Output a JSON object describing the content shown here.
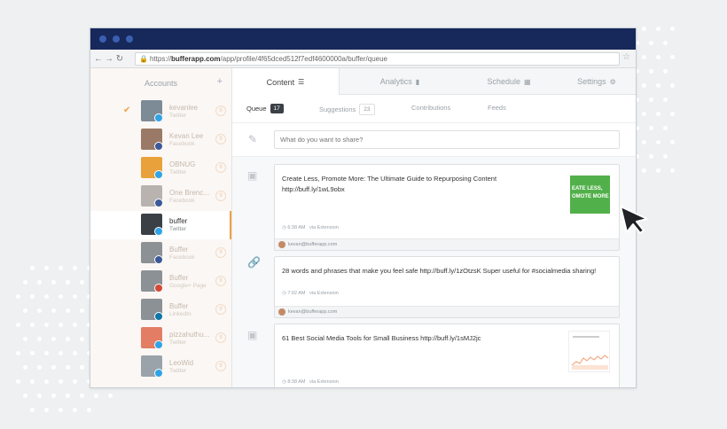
{
  "browser": {
    "url_prefix": "https://",
    "url_host": "bufferapp.com",
    "url_path": "/app/profile/4f65dced512f7edf4600000a/buffer/queue"
  },
  "sidebar": {
    "header": "Accounts",
    "add_symbol": "+",
    "accounts": [
      {
        "name": "kevanlee",
        "network": "Twitter",
        "count": "9",
        "checked": true
      },
      {
        "name": "Kevan Lee",
        "network": "Facebook",
        "count": "9"
      },
      {
        "name": "OBNUG",
        "network": "Twitter",
        "count": "9"
      },
      {
        "name": "One Brenc...",
        "network": "Facebook",
        "count": "9"
      },
      {
        "name": "buffer",
        "network": "Twitter",
        "count": "",
        "active": true
      },
      {
        "name": "Buffer",
        "network": "Facebook",
        "count": "9"
      },
      {
        "name": "Buffer",
        "network": "Google+ Page",
        "count": "9"
      },
      {
        "name": "Buffer",
        "network": "LinkedIn",
        "count": "9"
      },
      {
        "name": "pizzahuthu...",
        "network": "Twitter",
        "count": "9"
      },
      {
        "name": "LeoWid",
        "network": "Twitter",
        "count": "9"
      }
    ]
  },
  "tabs": {
    "content": "Content",
    "analytics": "Analytics",
    "schedule": "Schedule",
    "settings": "Settings"
  },
  "subtabs": {
    "queue": "Queue",
    "queue_count": "17",
    "suggestions": "Suggestions",
    "suggestions_count": "23",
    "contributions": "Contributions",
    "feeds": "Feeds"
  },
  "composer": {
    "placeholder": "What do you want to share?"
  },
  "posts": [
    {
      "text": "Create Less, Promote More: The Ultimate Guide to Repurposing Content http://buff.ly/1wL9obx",
      "time": "6:38 AM",
      "via": "via Extension",
      "author": "kevan@bufferapp.com",
      "thumb_text": "EATE LESS, OMOTE MORE"
    },
    {
      "text": "28 words and phrases that make you feel safe http://buff.ly/1zOtzsK Super useful for #socialmedia sharing!",
      "time": "7:02 AM",
      "via": "via Extension",
      "author": "kevan@bufferapp.com"
    },
    {
      "text": "61 Best Social Media Tools for Small Business http://buff.ly/1sMJ2jc",
      "time": "8:38 AM",
      "via": "via Extension"
    }
  ],
  "colors": {
    "titlebar": "#17285a",
    "accent_orange": "#f0a040",
    "thumb_green": "#52b04a",
    "twitter_blue": "#2fa3e6",
    "facebook_blue": "#3b5998"
  }
}
